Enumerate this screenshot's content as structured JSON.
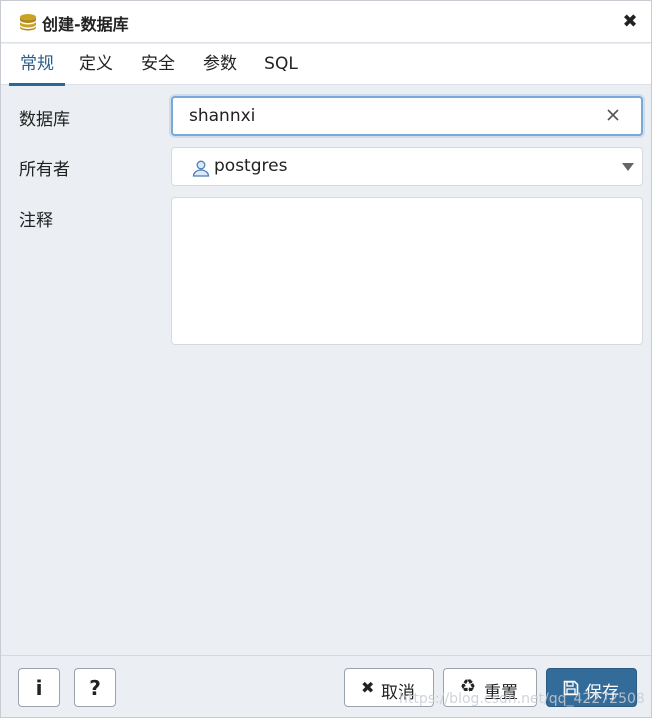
{
  "dialog": {
    "title": "创建-数据库",
    "title_icon": "database-icon",
    "close_icon": "close-icon",
    "close_glyph": "✖"
  },
  "tabs": [
    {
      "label": "常规",
      "active": true
    },
    {
      "label": "定义",
      "active": false
    },
    {
      "label": "安全",
      "active": false
    },
    {
      "label": "参数",
      "active": false
    },
    {
      "label": "SQL",
      "active": false
    }
  ],
  "form": {
    "database": {
      "label": "数据库",
      "value": "shannxi",
      "clear_icon": "clear-x-icon"
    },
    "owner": {
      "label": "所有者",
      "value": "postgres",
      "icon": "user-icon",
      "dropdown_icon": "caret-down-icon"
    },
    "comment": {
      "label": "注释",
      "value": ""
    }
  },
  "footer": {
    "info_glyph": "i",
    "help_glyph": "?",
    "cancel": {
      "label": "取消",
      "icon": "times-icon",
      "glyph": "✖"
    },
    "reset": {
      "label": "重置",
      "icon": "recycle-icon",
      "glyph": "♻"
    },
    "save": {
      "label": "保存",
      "icon": "save-icon"
    }
  },
  "watermark": "https://blog.csdn.net/qq_42272508",
  "colors": {
    "accent": "#336b99",
    "focus_border": "#7aa8d8",
    "background": "#ebeef3",
    "db_icon": "#c9a227"
  }
}
